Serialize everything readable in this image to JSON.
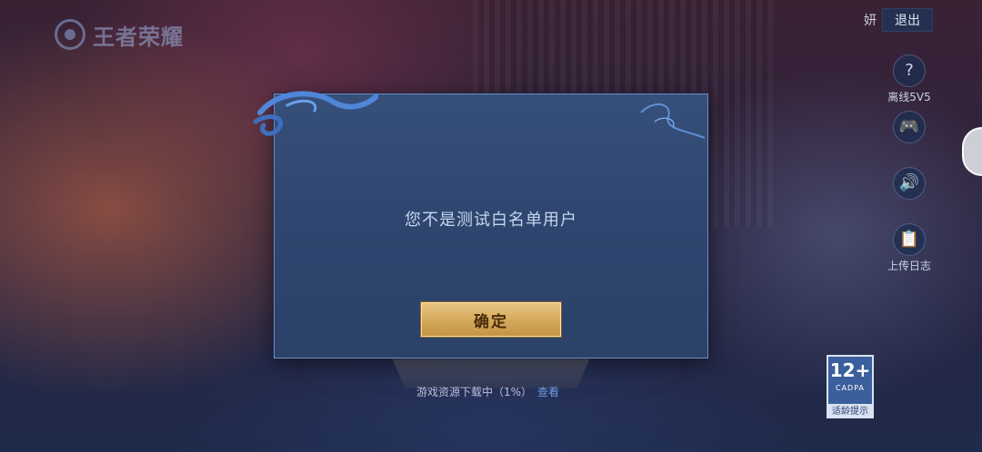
{
  "game": {
    "logo_text": "王者荣耀"
  },
  "account": {
    "username": "妍",
    "logout_label": "退出"
  },
  "side_tools": [
    {
      "label": "离线5V5",
      "icon": "question-icon"
    },
    {
      "label": "",
      "icon": "gamepad-icon"
    },
    {
      "label": "",
      "icon": "speaker-icon"
    },
    {
      "label": "上传日志",
      "icon": "clipboard-icon"
    }
  ],
  "dialog": {
    "message": "您不是测试白名单用户",
    "confirm_label": "确定"
  },
  "loading": {
    "status_text": "游戏资源下载中（1%）",
    "progress_percent": 1,
    "view_label": "查看"
  },
  "rating": {
    "age": "12+",
    "org": "CADPA",
    "tip": "适龄提示"
  },
  "colors": {
    "dialog_bg": "#2f4670",
    "accent_gold": "#d8ad62",
    "link_blue": "#6f9cdf"
  }
}
